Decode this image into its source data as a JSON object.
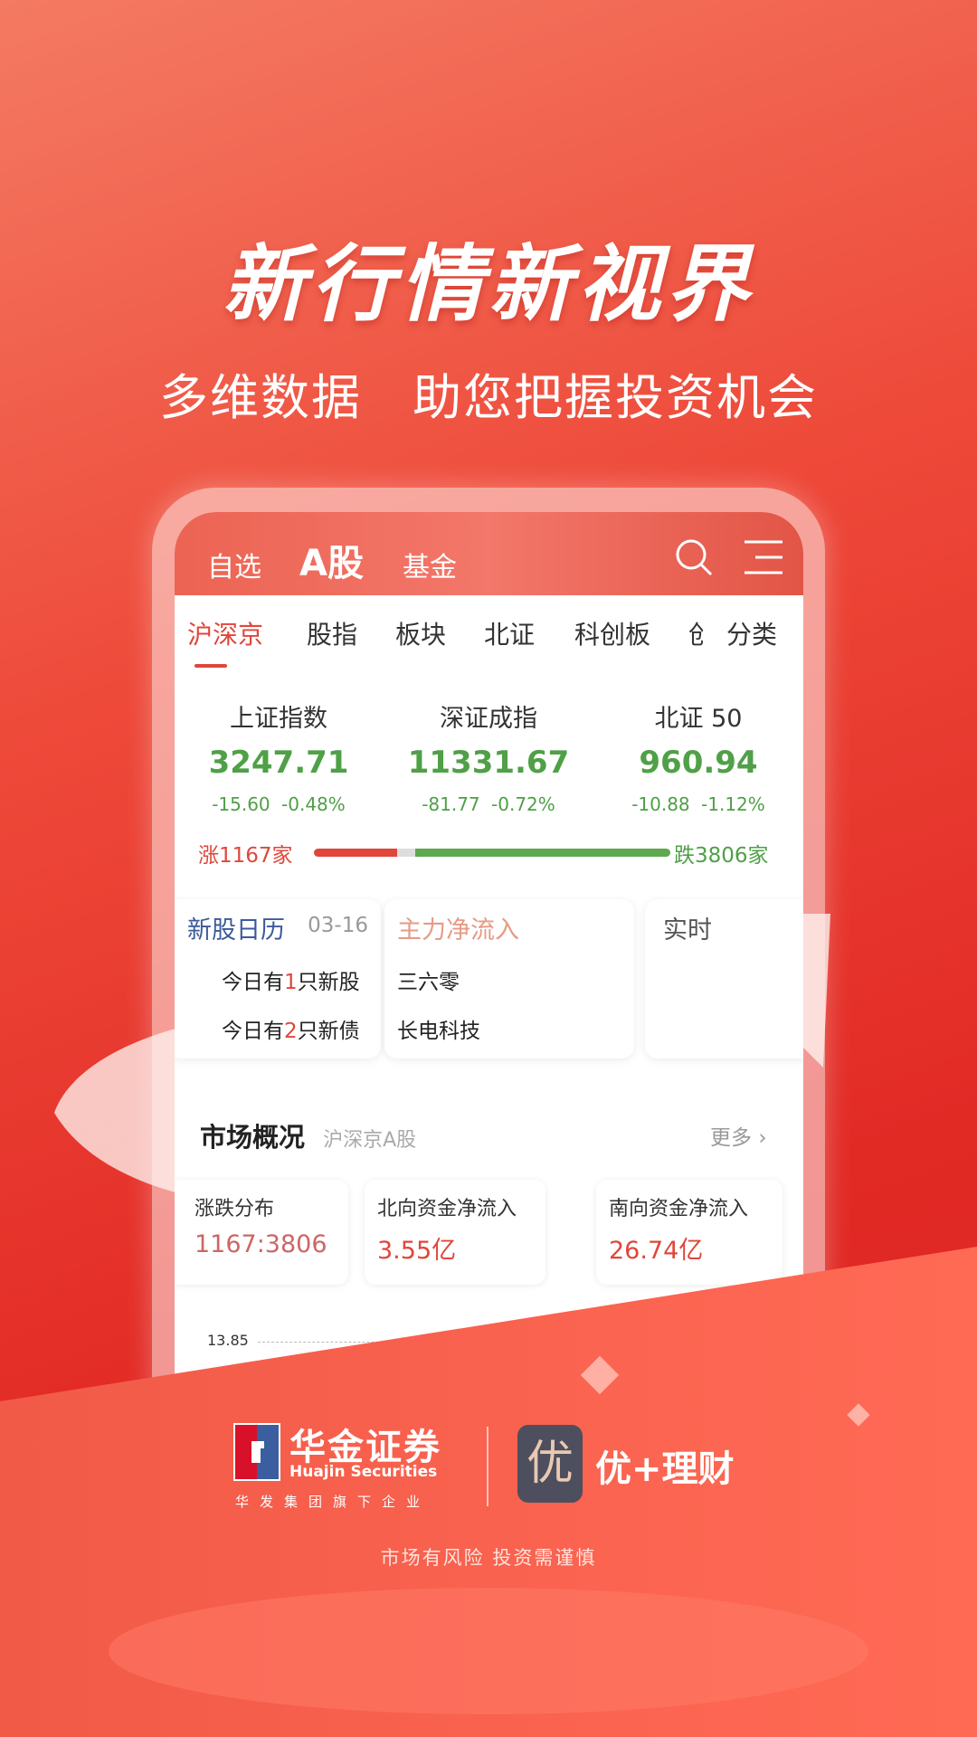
{
  "headline": "新行情新视界",
  "subline": "多维数据　助您把握投资机会",
  "header": {
    "tabs": [
      {
        "label": "自选"
      },
      {
        "label": "A股"
      },
      {
        "label": "基金"
      }
    ],
    "active": "A股",
    "search_icon": "search-icon",
    "menu_icon": "menu-icon"
  },
  "subtabs": [
    {
      "label": "沪深京"
    },
    {
      "label": "股指"
    },
    {
      "label": "板块"
    },
    {
      "label": "北证"
    },
    {
      "label": "科创板"
    },
    {
      "label": "创"
    },
    {
      "label": "分类"
    }
  ],
  "indices": [
    {
      "name": "上证指数",
      "value": "3247.71",
      "change": "-15.60",
      "pct": "-0.48%"
    },
    {
      "name": "深证成指",
      "value": "11331.67",
      "change": "-81.77",
      "pct": "-0.72%"
    },
    {
      "name": "北证 50",
      "value": "960.94",
      "change": "-10.88",
      "pct": "-1.12%"
    }
  ],
  "breadth": {
    "up_label": "涨1167家",
    "down_label": "跌3806家",
    "up": 1167,
    "down": 3806
  },
  "cards": {
    "ipo": {
      "title": "新股日历",
      "date": "03-16",
      "line1_pre": "今日有",
      "line1_num": "1",
      "line1_post": "只新股",
      "line2_pre": "今日有",
      "line2_num": "2",
      "line2_post": "只新债"
    },
    "flow": {
      "title": "主力净流入",
      "items": [
        "三六零",
        "长电科技"
      ]
    },
    "realtime": {
      "title": "实时"
    }
  },
  "market": {
    "title": "市场概况",
    "sub": "沪深京A股",
    "more": "更多",
    "cards": [
      {
        "label": "涨跌分布",
        "value": "1167:3806"
      },
      {
        "label": "北向资金净流入",
        "value": "3.55亿"
      },
      {
        "label": "南向资金净流入",
        "value": "26.74亿"
      }
    ],
    "chart_tick": "13.85"
  },
  "brand": {
    "name": "华金证券",
    "en": "Huajin Securities",
    "group": "华发集团旗下企业",
    "app_icon_char": "优",
    "app_name": "优+理财"
  },
  "disclaimer": "市场有风险 投资需谨慎",
  "colors": {
    "red": "#e0463a",
    "green": "#4fa047",
    "bg": "#e22a25"
  }
}
